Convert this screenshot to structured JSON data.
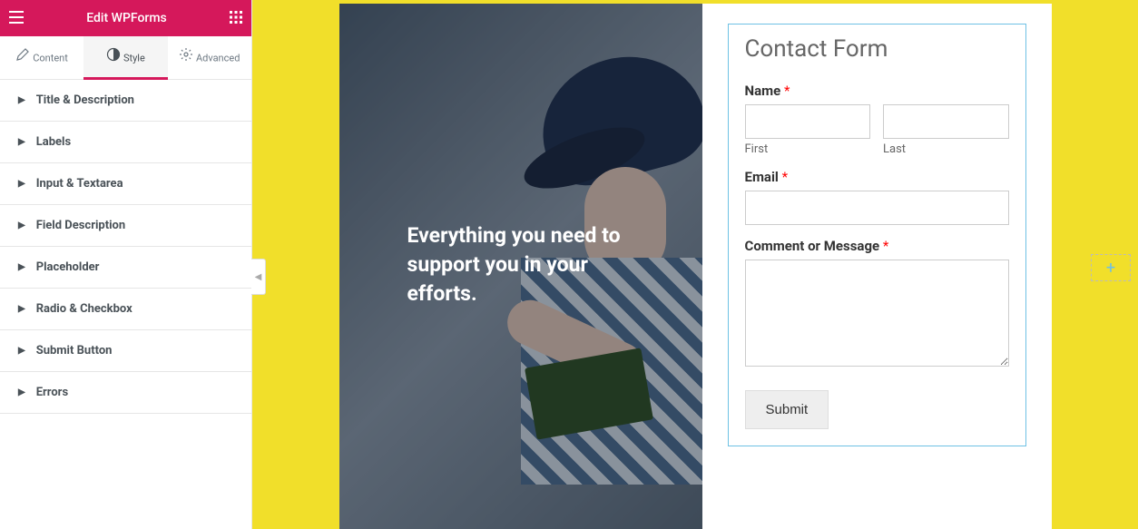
{
  "header": {
    "title": "Edit WPForms"
  },
  "tabs": [
    {
      "label": "Content"
    },
    {
      "label": "Style"
    },
    {
      "label": "Advanced"
    }
  ],
  "active_tab_index": 1,
  "sections": [
    {
      "label": "Title & Description"
    },
    {
      "label": "Labels"
    },
    {
      "label": "Input & Textarea"
    },
    {
      "label": "Field Description"
    },
    {
      "label": "Placeholder"
    },
    {
      "label": "Radio & Checkbox"
    },
    {
      "label": "Submit Button"
    },
    {
      "label": "Errors"
    }
  ],
  "hero": {
    "heading": "Everything you need to support you in your efforts."
  },
  "form": {
    "title": "Contact Form",
    "name_label": "Name",
    "first_sub": "First",
    "last_sub": "Last",
    "email_label": "Email",
    "message_label": "Comment or Message",
    "required": "*",
    "submit_label": "Submit"
  },
  "icons": {
    "add": "+"
  }
}
